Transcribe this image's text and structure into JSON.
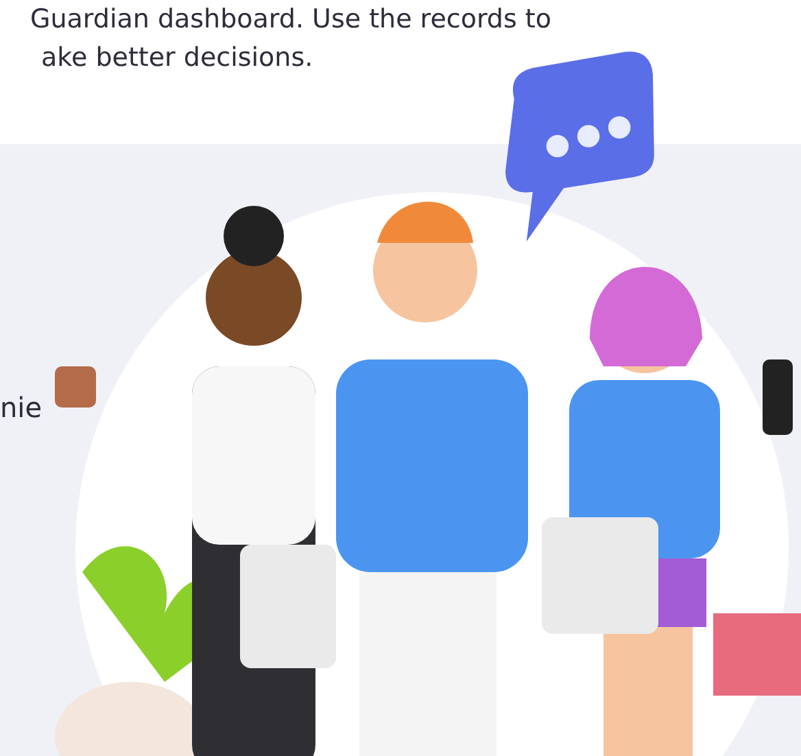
{
  "intro": {
    "lines": [
      "Guardian dashboard. Use the records to",
      "ake better decisions."
    ]
  },
  "side_text": "nie"
}
